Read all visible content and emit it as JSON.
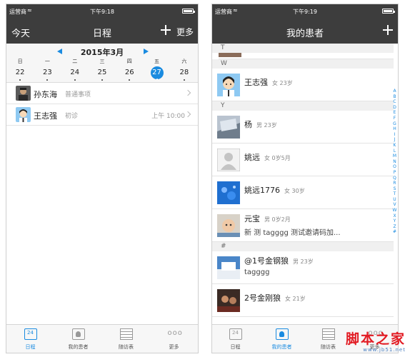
{
  "left": {
    "status": {
      "carrier": "运营商",
      "time": "下午9:18"
    },
    "nav": {
      "left": "今天",
      "title": "日程",
      "more": "更多"
    },
    "calendar": {
      "month": "2015年3月",
      "weekdays": [
        "日",
        "一",
        "二",
        "三",
        "四",
        "五",
        "六"
      ],
      "dates": [
        "22",
        "23",
        "24",
        "25",
        "26",
        "27",
        "28"
      ],
      "selected_date": "27"
    },
    "schedule": [
      {
        "name": "孙东海",
        "type": "普通事项",
        "time": ""
      },
      {
        "name": "王志强",
        "type": "初诊",
        "time": "上午 10:00"
      }
    ],
    "tabs": [
      {
        "icon": "calendar-icon",
        "label": "日程",
        "glyph": "24"
      },
      {
        "icon": "patients-icon",
        "label": "我的患者"
      },
      {
        "icon": "followup-table-icon",
        "label": "随访表"
      },
      {
        "icon": "more-icon",
        "label": "更多",
        "glyph": "ooo"
      }
    ]
  },
  "right": {
    "status": {
      "carrier": "运营商",
      "time": "下午9:19"
    },
    "nav": {
      "title": "我的患者"
    },
    "sections": {
      "t": "T",
      "w": "W",
      "y": "Y",
      "hash": "#"
    },
    "patients": [
      {
        "name": "王志强",
        "info": "女 23岁",
        "note": ""
      },
      {
        "name": "杨",
        "info": "男 23岁",
        "note": ""
      },
      {
        "name": "姚远",
        "info": "女 0岁5月",
        "note": ""
      },
      {
        "name": "姚远1776",
        "info": "女 30岁",
        "note": ""
      },
      {
        "name": "元宝",
        "info": "男 0岁2月",
        "note": "新 测 tagggg 测试邀请码加..."
      },
      {
        "name": "@1号金钢狼",
        "info": "男 23岁",
        "note": "tagggg"
      },
      {
        "name": "2号金刚狼",
        "info": "女 21岁",
        "note": ""
      }
    ],
    "index_letters": [
      "A",
      "B",
      "C",
      "D",
      "E",
      "F",
      "G",
      "H",
      "I",
      "J",
      "K",
      "L",
      "M",
      "N",
      "O",
      "P",
      "Q",
      "R",
      "S",
      "T",
      "U",
      "V",
      "W",
      "X",
      "Y",
      "Z",
      "#"
    ],
    "tabs": [
      {
        "label": "日程",
        "glyph": "24"
      },
      {
        "label": "我的患者"
      },
      {
        "label": "随访表"
      },
      {
        "label": "更多"
      }
    ]
  },
  "watermark": {
    "main": "脚本之家",
    "sub": "www.jb51.net"
  },
  "colors": {
    "header": "#3d3d3d",
    "accent": "#1a8be0",
    "watermark": "#e21b23"
  }
}
